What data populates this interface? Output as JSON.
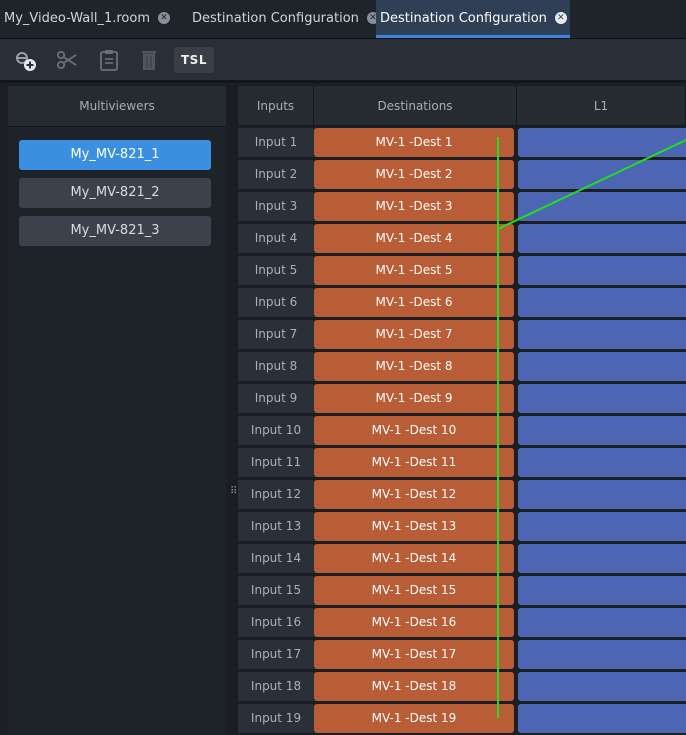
{
  "tabs": [
    {
      "label": "My_Video-Wall_1.room",
      "active": false
    },
    {
      "label": "Destination Configuration",
      "active": false
    },
    {
      "label": "Destination Configuration",
      "active": true
    }
  ],
  "toolbar": {
    "tsl_label": "TSL"
  },
  "multiviewers": {
    "header": "Multiviewers",
    "items": [
      "My_MV-821_1",
      "My_MV-821_2",
      "My_MV-821_3"
    ],
    "selected_index": 0
  },
  "grid": {
    "columns": {
      "inputs": "Inputs",
      "destinations": "Destinations",
      "l1": "L1"
    },
    "rows": [
      {
        "input": "Input 1",
        "destination": "MV-1 -Dest 1"
      },
      {
        "input": "Input 2",
        "destination": "MV-1 -Dest 2"
      },
      {
        "input": "Input 3",
        "destination": "MV-1 -Dest 3"
      },
      {
        "input": "Input 4",
        "destination": "MV-1 -Dest 4"
      },
      {
        "input": "Input 5",
        "destination": "MV-1 -Dest 5"
      },
      {
        "input": "Input 6",
        "destination": "MV-1 -Dest 6"
      },
      {
        "input": "Input 7",
        "destination": "MV-1 -Dest 7"
      },
      {
        "input": "Input 8",
        "destination": "MV-1 -Dest 8"
      },
      {
        "input": "Input 9",
        "destination": "MV-1 -Dest 9"
      },
      {
        "input": "Input 10",
        "destination": "MV-1 -Dest 10"
      },
      {
        "input": "Input 11",
        "destination": "MV-1 -Dest 11"
      },
      {
        "input": "Input 12",
        "destination": "MV-1 -Dest 12"
      },
      {
        "input": "Input 13",
        "destination": "MV-1 -Dest 13"
      },
      {
        "input": "Input 14",
        "destination": "MV-1 -Dest 14"
      },
      {
        "input": "Input 15",
        "destination": "MV-1 -Dest 15"
      },
      {
        "input": "Input 16",
        "destination": "MV-1 -Dest 16"
      },
      {
        "input": "Input 17",
        "destination": "MV-1 -Dest 17"
      },
      {
        "input": "Input 18",
        "destination": "MV-1 -Dest 18"
      },
      {
        "input": "Input 19",
        "destination": "MV-1 -Dest 19"
      }
    ]
  },
  "colors": {
    "accent": "#3b8fe0",
    "destination_cell": "#b95d37",
    "l1_cell": "#4d66b3",
    "annotation_line": "#22dd22"
  }
}
